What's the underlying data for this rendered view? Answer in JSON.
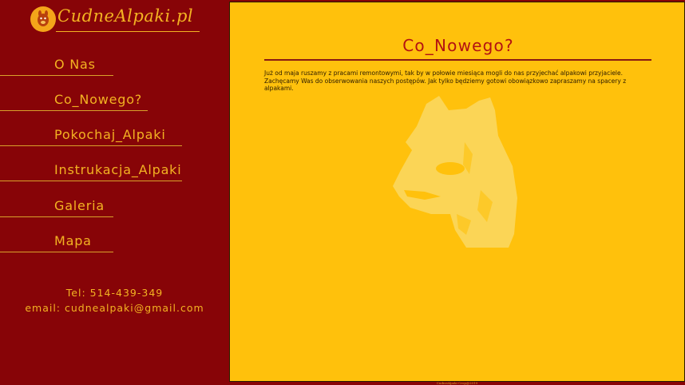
{
  "logo": {
    "text": "CudneAlpaki.pl"
  },
  "nav": {
    "items": [
      {
        "label": "O Nas"
      },
      {
        "label": "Co_Nowego?"
      },
      {
        "label": "Pokochaj_Alpaki"
      },
      {
        "label": "Instrukacja_Alpaki"
      },
      {
        "label": "Galeria"
      },
      {
        "label": "Mapa"
      }
    ]
  },
  "contact": {
    "phone": "Tel: 514-439-349",
    "email": "email: cudnealpaki@gmail.com"
  },
  "main": {
    "title": "Co_Nowego?",
    "paragraph": "Już od maja ruszamy z pracami remontowymi, tak by w połowie miesiąca mogli do nas przyjechać alpakowi przyjaciele. Zachęcamy Was do obserwowania naszych postępów. Jak tylko będziemy gotowi obowiązkowo zapraszamy na spacery z alpakami."
  },
  "footer": {
    "text": "CudneAlpaki Crop@2019"
  },
  "colors": {
    "sidebar_bg": "#870407",
    "main_bg": "#ffc10c",
    "accent_text": "#f3b322",
    "title_red": "#b31212"
  }
}
